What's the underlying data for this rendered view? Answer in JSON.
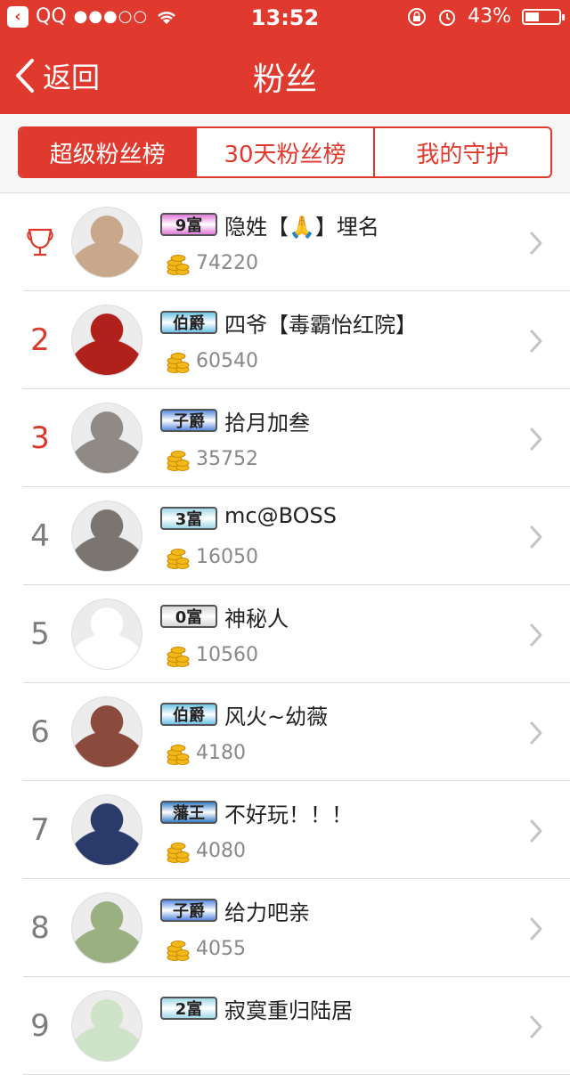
{
  "status_bar": {
    "carrier": "QQ",
    "signal": "●●●○○",
    "time": "13:52",
    "battery_text": "43%",
    "battery_level": 0.43
  },
  "nav": {
    "back_label": "返回",
    "title": "粉丝"
  },
  "tabs": [
    {
      "label": "超级粉丝榜",
      "active": true
    },
    {
      "label": "30天粉丝榜",
      "active": false
    },
    {
      "label": "我的守护",
      "active": false
    }
  ],
  "fans": [
    {
      "rank": "",
      "trophy": true,
      "badge": "9富",
      "badge_color": "#e07ad8",
      "name": "隐姓【🙏】埋名",
      "score": "74220",
      "avatar_color": "#c8a78a"
    },
    {
      "rank": "2",
      "badge": "伯爵",
      "badge_color": "#6fc3e8",
      "name": "四爷【毒霸怡红院】",
      "score": "60540",
      "avatar_color": "#b0211c"
    },
    {
      "rank": "3",
      "badge": "子爵",
      "badge_color": "#5a8ae0",
      "name": "拾月加叁",
      "score": "35752",
      "avatar_color": "#8f8a86"
    },
    {
      "rank": "4",
      "badge": "3富",
      "badge_color": "#9fd8e8",
      "name": "mc@BOSS",
      "score": "16050",
      "avatar_color": "#7a7570"
    },
    {
      "rank": "5",
      "badge": "0富",
      "badge_color": "#d6d6d6",
      "name": "神秘人",
      "score": "10560",
      "avatar_color": "#ffffff"
    },
    {
      "rank": "6",
      "badge": "伯爵",
      "badge_color": "#6fc3e8",
      "name": "风火~幼薇",
      "score": "4180",
      "avatar_color": "#8a4a3c"
    },
    {
      "rank": "7",
      "badge": "藩王",
      "badge_color": "#3a7fc8",
      "name": "不好玩！！！",
      "score": "4080",
      "avatar_color": "#2a3a6a"
    },
    {
      "rank": "8",
      "badge": "子爵",
      "badge_color": "#5a8ae0",
      "name": "给力吧亲",
      "score": "4055",
      "avatar_color": "#9ab080"
    },
    {
      "rank": "9",
      "badge": "2富",
      "badge_color": "#9fd8e8",
      "name": "寂寞重归陆居",
      "score": "",
      "avatar_color": "#cfe3c8"
    }
  ],
  "colors": {
    "accent": "#e03a2e",
    "coin": "#f2b81a"
  },
  "icons": {
    "back": "chevron-left-icon",
    "trophy": "trophy-icon",
    "coin": "coin-stack-icon",
    "row_arrow": "chevron-right-icon"
  }
}
